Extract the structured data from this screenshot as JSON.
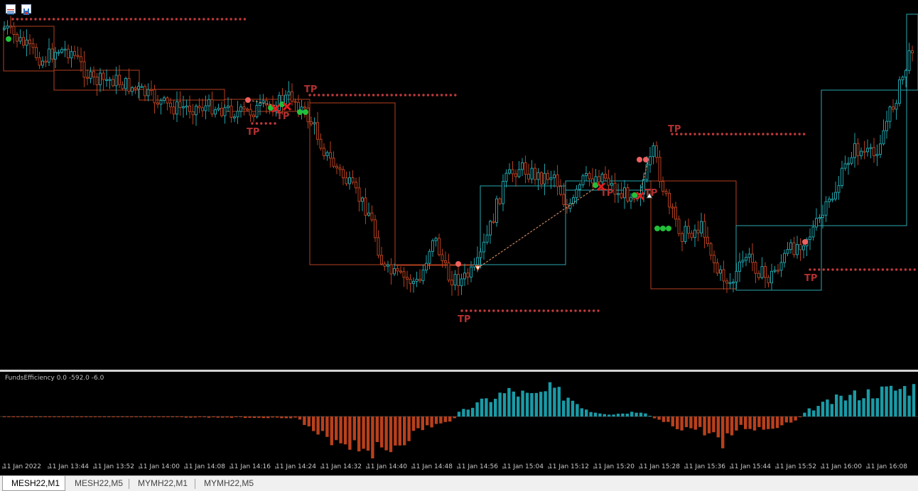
{
  "indicator": {
    "title": "FundsEfficiency 0.0 -592.0 -6.0"
  },
  "trade_labels": {
    "tp": "TP"
  },
  "time_axis": [
    "11 Jan 2022",
    "11 Jan 13:44",
    "11 Jan 13:52",
    "11 Jan 14:00",
    "11 Jan 14:08",
    "11 Jan 14:16",
    "11 Jan 14:24",
    "11 Jan 14:32",
    "11 Jan 14:40",
    "11 Jan 14:48",
    "11 Jan 14:56",
    "11 Jan 15:04",
    "11 Jan 15:12",
    "11 Jan 15:20",
    "11 Jan 15:28",
    "11 Jan 15:36",
    "11 Jan 15:44",
    "11 Jan 15:52",
    "11 Jan 16:00",
    "11 Jan 16:08"
  ],
  "tabs": [
    {
      "label": "MESH22,M1",
      "active": true
    },
    {
      "label": "MESH22,M5",
      "active": false
    },
    {
      "label": "MYMH22,M1",
      "active": false
    },
    {
      "label": "MYMH22,M5",
      "active": false
    }
  ],
  "colors": {
    "bull_candle": "#20a0a8",
    "bear_candle": "#b5401f",
    "hist_pos": "#1a9aa6",
    "hist_neg": "#b8401c",
    "tp_dots": "#c0393b",
    "buy_marker": "#22c03a",
    "sell_marker": "#f06060",
    "stop_cross": "#e01e1e",
    "box_bull": "#2aa9b0",
    "box_bear": "#b5401f"
  },
  "chart_icons": [
    "trade-list-icon",
    "chart-save-icon"
  ]
}
